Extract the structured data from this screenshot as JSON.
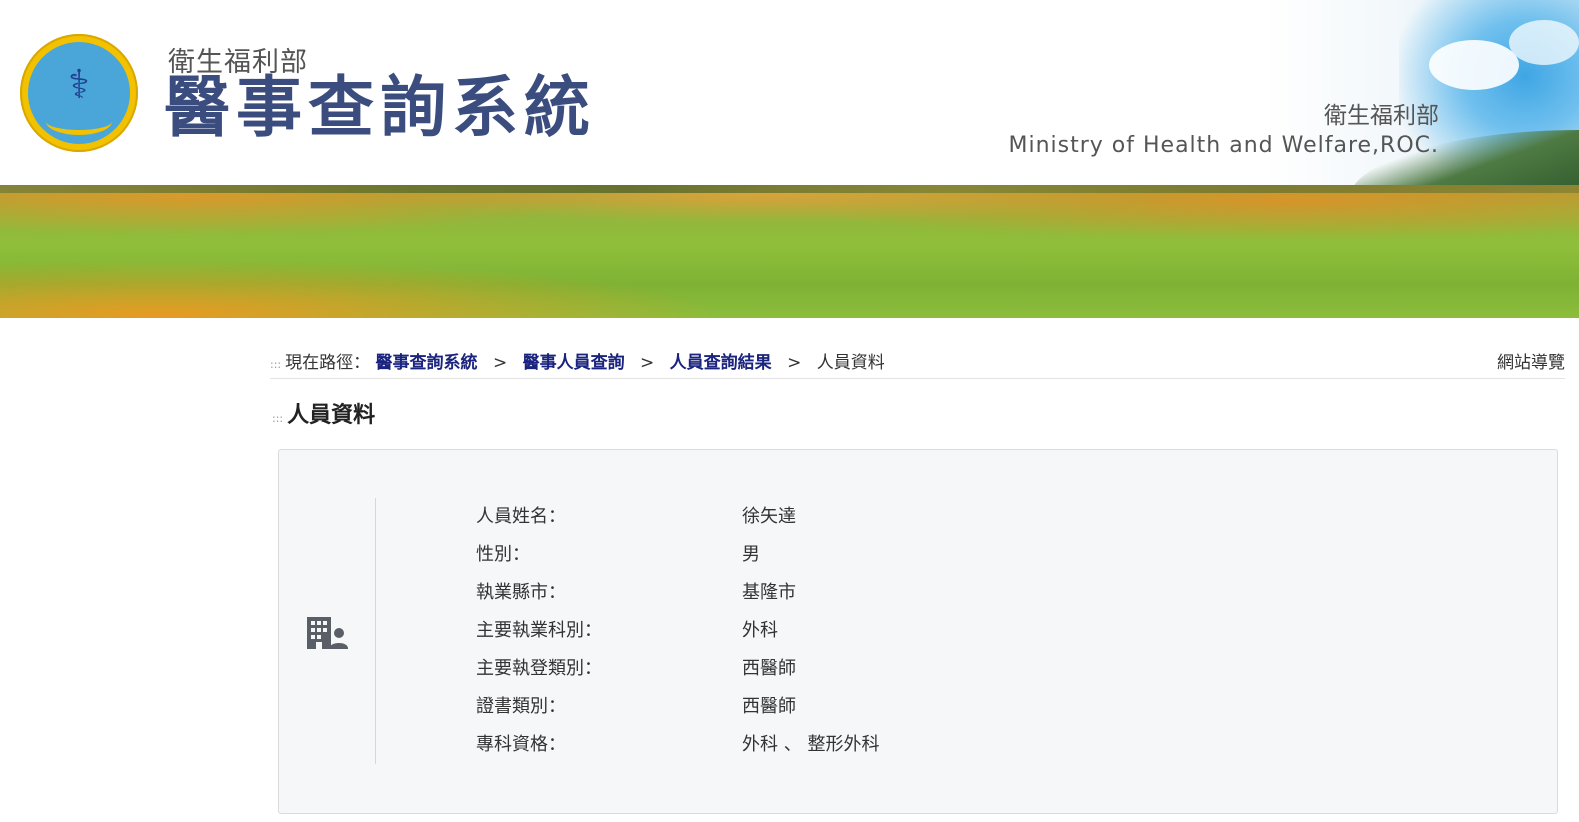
{
  "header": {
    "ministry_small": "衛生福利部",
    "system_title": "醫事查詢系統",
    "ministry_right_zh": "衛生福利部",
    "ministry_right_en": "Ministry of Health and Welfare,ROC."
  },
  "breadcrumb": {
    "prefix": "現在路徑：",
    "items": [
      "醫事查詢系統",
      "醫事人員查詢",
      "人員查詢結果"
    ],
    "current": "人員資料",
    "separator": ">",
    "sitemap_label": "網站導覽"
  },
  "page": {
    "title": "人員資料"
  },
  "card": {
    "icon": "building-person-icon",
    "rows": [
      {
        "label": "人員姓名：",
        "value": "徐矢達"
      },
      {
        "label": "性別：",
        "value": "男"
      },
      {
        "label": "執業縣市：",
        "value": "基隆市"
      },
      {
        "label": "主要執業科別：",
        "value": "外科"
      },
      {
        "label": "主要執登類別：",
        "value": "西醫師"
      },
      {
        "label": "證書類別：",
        "value": "西醫師"
      },
      {
        "label": "專科資格：",
        "value": "外科 、 整形外科"
      }
    ]
  },
  "colors": {
    "link": "#1a237e",
    "title_blue": "#3b4d7e",
    "card_bg": "#f6f7f9",
    "logo_yellow": "#f2c100",
    "logo_blue": "#4aa6d9"
  }
}
